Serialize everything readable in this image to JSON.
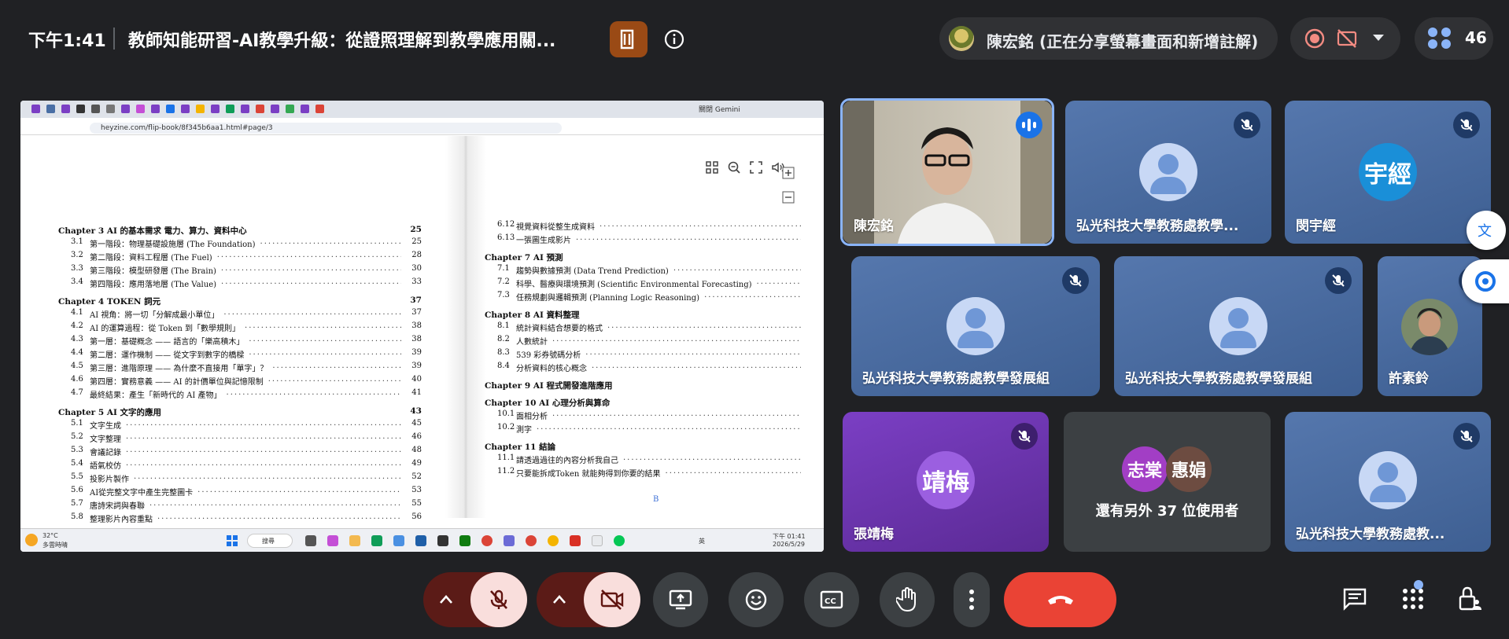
{
  "header": {
    "time": "下午1:41",
    "meeting_title": "教師知能研習-AI教學升級：從證照理解到教學應用關...",
    "presenter_status": "陳宏銘 (正在分享螢幕畫面和新增註解)",
    "participant_count": "46"
  },
  "shared_screen": {
    "browser_tab_title": "關閉 Gemini",
    "url": "heyzine.com/flip-book/8f345b6aa1.html#page/3",
    "left_toc": [
      {
        "chapter": "Chapter 3   AI 的基本需求 電力、算力、資料中心",
        "page": "25",
        "items": [
          {
            "num": "3.1",
            "label": "第一階段：物理基礎設施層 (The Foundation)",
            "page": "25"
          },
          {
            "num": "3.2",
            "label": "第二階段：資料工程層 (The Fuel)",
            "page": "28"
          },
          {
            "num": "3.3",
            "label": "第三階段：模型研發層 (The Brain)",
            "page": "30"
          },
          {
            "num": "3.4",
            "label": "第四階段：應用落地層 (The Value)",
            "page": "33"
          }
        ]
      },
      {
        "chapter": "Chapter 4   TOKEN 詞元",
        "page": "37",
        "items": [
          {
            "num": "4.1",
            "label": "AI 視角：將一切「分解成最小單位」",
            "page": "37"
          },
          {
            "num": "4.2",
            "label": "AI 的運算過程：從 Token 到「數學規則」",
            "page": "38"
          },
          {
            "num": "4.3",
            "label": "第一層：基礎概念 —— 語言的「樂高積木」",
            "page": "38"
          },
          {
            "num": "4.4",
            "label": "第二層：運作機制 —— 從文字到數字的橋樑",
            "page": "39"
          },
          {
            "num": "4.5",
            "label": "第三層：進階原理 —— 為什麼不直接用「單字」？",
            "page": "39"
          },
          {
            "num": "4.6",
            "label": "第四層：實務意義 —— AI 的計價單位與記憶限制",
            "page": "40"
          },
          {
            "num": "4.7",
            "label": "最終結果：產生「新時代的 AI 產物」",
            "page": "41"
          }
        ]
      },
      {
        "chapter": "Chapter 5   AI 文字的應用",
        "page": "43",
        "items": [
          {
            "num": "5.1",
            "label": "文字生成",
            "page": "45"
          },
          {
            "num": "5.2",
            "label": "文字整理",
            "page": "46"
          },
          {
            "num": "5.3",
            "label": "會議記錄",
            "page": "48"
          },
          {
            "num": "5.4",
            "label": "語氣校仿",
            "page": "49"
          },
          {
            "num": "5.5",
            "label": "投影片製作",
            "page": "52"
          },
          {
            "num": "5.6",
            "label": "AI從完整文字中產生完整圖卡",
            "page": "53"
          },
          {
            "num": "5.7",
            "label": "唐詩宋詞與春聯",
            "page": "55"
          },
          {
            "num": "5.8",
            "label": "整理影片內容重點",
            "page": "56"
          }
        ]
      }
    ],
    "right_toc": [
      {
        "chapter": "",
        "items": [
          {
            "num": "6.12",
            "label": "視覺資料從整生成資料",
            "page": ""
          },
          {
            "num": "6.13",
            "label": "一張圖生成影片",
            "page": ""
          }
        ]
      },
      {
        "chapter": "Chapter 7   AI 預測",
        "items": [
          {
            "num": "7.1",
            "label": "趨勢與數據預測 (Data Trend Prediction)",
            "page": ""
          },
          {
            "num": "7.2",
            "label": "科學、醫療與環境預測 (Scientific Environmental Forecasting)",
            "page": ""
          },
          {
            "num": "7.3",
            "label": "任務規劃與邏輯預測 (Planning Logic Reasoning)",
            "page": ""
          }
        ]
      },
      {
        "chapter": "Chapter 8   AI 資料整理",
        "items": [
          {
            "num": "8.1",
            "label": "統計資料結合想要的格式",
            "page": ""
          },
          {
            "num": "8.2",
            "label": "人數統計",
            "page": ""
          },
          {
            "num": "8.3",
            "label": "539 彩券號碼分析",
            "page": ""
          },
          {
            "num": "8.4",
            "label": "分析資料的核心概念",
            "page": ""
          }
        ]
      },
      {
        "chapter": "Chapter 9   AI 程式開發進階應用",
        "items": []
      },
      {
        "chapter": "Chapter 10  AI 心理分析與算命",
        "items": [
          {
            "num": "10.1",
            "label": "面相分析",
            "page": ""
          },
          {
            "num": "10.2",
            "label": "測字",
            "page": ""
          }
        ]
      },
      {
        "chapter": "Chapter 11  結論",
        "items": [
          {
            "num": "11.1",
            "label": "請透過過往的內容分析我自己",
            "page": ""
          },
          {
            "num": "11.2",
            "label": "只要能拆成Token 就能夠得到你要的結果",
            "page": ""
          }
        ]
      }
    ],
    "page_marker": "B",
    "taskbar": {
      "weather_temp": "32°C",
      "weather_desc": "多雲時晴",
      "search_label": "搜尋",
      "ime": "英",
      "clock_time": "下午 01:41",
      "clock_date": "2026/5/29"
    }
  },
  "tiles": [
    {
      "id": "speaker",
      "name": "陳宏銘"
    },
    {
      "id": "t2",
      "name": "弘光科技大學教務處教學..."
    },
    {
      "id": "t3",
      "name": "閔宇經",
      "initials": "宇經",
      "color": "#1a8fd8"
    },
    {
      "id": "t4",
      "name": "弘光科技大學教務處教學發展組"
    },
    {
      "id": "t5",
      "name": "弘光科技大學教務處教學發展組"
    },
    {
      "id": "t6",
      "name": "許素鈴"
    },
    {
      "id": "t7",
      "name": "張靖梅",
      "initials": "靖梅",
      "color": "#8e4fd1"
    },
    {
      "id": "t8",
      "others": "還有另外 37 位使用者",
      "a1": "志棠",
      "a2": "惠娟",
      "a1_color": "#a23ec5",
      "a2_color": "#6d4c41"
    },
    {
      "id": "t9",
      "name": "弘光科技大學教務處教..."
    }
  ],
  "colors": {
    "background": "#202124",
    "tile_blue": "#4a6fa5",
    "hangup_red": "#ea4335",
    "muted_pink": "#f9dedc",
    "speaker_outline": "#8ab4f8"
  }
}
